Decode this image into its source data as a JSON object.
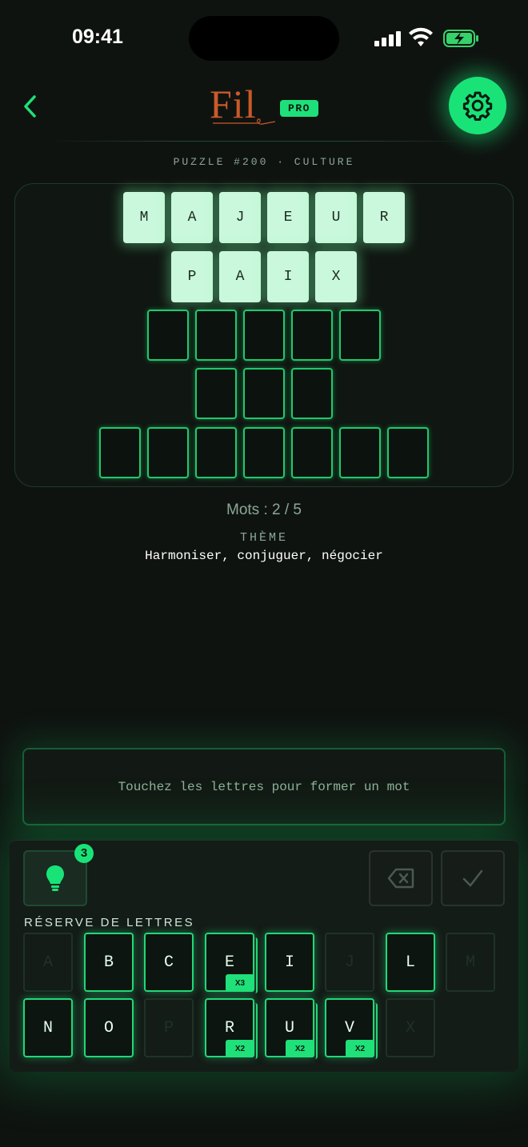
{
  "status": {
    "time": "09:41"
  },
  "header": {
    "logo": "Fil",
    "badge": "PRO"
  },
  "puzzle": {
    "label": "PUZZLE #200 · CULTURE"
  },
  "board": {
    "words": [
      {
        "letters": [
          "M",
          "A",
          "J",
          "E",
          "U",
          "R"
        ],
        "solved": true
      },
      {
        "letters": [
          "P",
          "A",
          "I",
          "X"
        ],
        "solved": true
      },
      {
        "letters": [
          "",
          "",
          "",
          "",
          ""
        ],
        "solved": false
      },
      {
        "letters": [
          "",
          "",
          ""
        ],
        "solved": false
      },
      {
        "letters": [
          "",
          "",
          "",
          "",
          "",
          "",
          ""
        ],
        "solved": false
      }
    ]
  },
  "progress": {
    "text": "Mots : 2 / 5"
  },
  "theme": {
    "label": "THÈME",
    "value": "Harmoniser, conjuguer, négocier"
  },
  "input": {
    "placeholder": "Touchez les lettres pour former un mot"
  },
  "hint": {
    "count": "3"
  },
  "reserve": {
    "label": "RÉSERVE DE LETTRES",
    "keys": [
      {
        "letter": "A",
        "enabled": false,
        "mult": ""
      },
      {
        "letter": "B",
        "enabled": true,
        "mult": ""
      },
      {
        "letter": "C",
        "enabled": true,
        "mult": ""
      },
      {
        "letter": "E",
        "enabled": true,
        "mult": "X3"
      },
      {
        "letter": "I",
        "enabled": true,
        "mult": ""
      },
      {
        "letter": "J",
        "enabled": false,
        "mult": ""
      },
      {
        "letter": "L",
        "enabled": true,
        "mult": ""
      },
      {
        "letter": "M",
        "enabled": false,
        "mult": ""
      },
      {
        "letter": "N",
        "enabled": true,
        "mult": ""
      },
      {
        "letter": "O",
        "enabled": true,
        "mult": ""
      },
      {
        "letter": "P",
        "enabled": false,
        "mult": ""
      },
      {
        "letter": "R",
        "enabled": true,
        "mult": "X2"
      },
      {
        "letter": "U",
        "enabled": true,
        "mult": "X2"
      },
      {
        "letter": "V",
        "enabled": true,
        "mult": "X2"
      },
      {
        "letter": "X",
        "enabled": false,
        "mult": ""
      }
    ]
  },
  "colors": {
    "accent": "#19e377",
    "logo": "#c95a2a",
    "background": "#0f1310"
  }
}
